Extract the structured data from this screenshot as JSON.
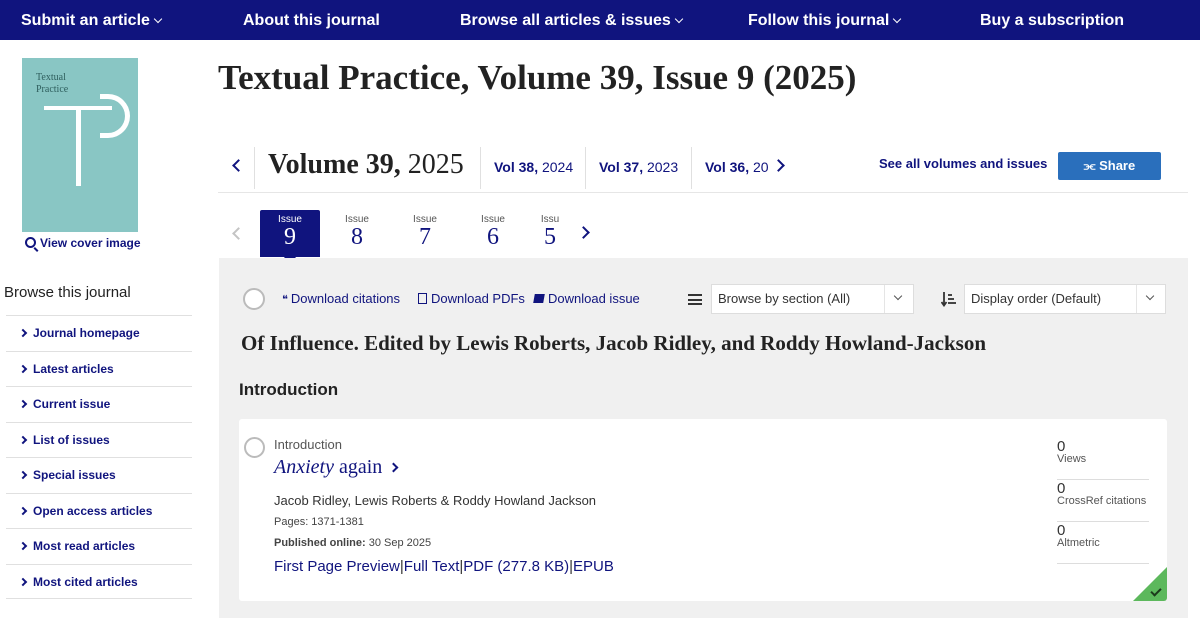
{
  "topnav": {
    "items": [
      {
        "label": "Submit an article",
        "dropdown": true
      },
      {
        "label": "About this journal",
        "dropdown": false
      },
      {
        "label": "Browse all articles & issues",
        "dropdown": true
      },
      {
        "label": "Follow this journal",
        "dropdown": true
      },
      {
        "label": "Buy a subscription",
        "dropdown": false
      }
    ]
  },
  "cover": {
    "title_line1": "Textual",
    "title_line2": "Practice",
    "view_label": "View cover image"
  },
  "sidebar": {
    "title": "Browse this journal",
    "items": [
      {
        "label": "Journal homepage"
      },
      {
        "label": "Latest articles"
      },
      {
        "label": "Current issue"
      },
      {
        "label": "List of issues"
      },
      {
        "label": "Special issues"
      },
      {
        "label": "Open access articles"
      },
      {
        "label": "Most read articles"
      },
      {
        "label": "Most cited articles"
      }
    ]
  },
  "page_title": "Textual Practice, Volume 39, Issue 9 (2025)",
  "volumes": {
    "current_label": "Volume 39,",
    "current_year": "2025",
    "others": [
      {
        "vol": "Vol 38,",
        "year": "2024"
      },
      {
        "vol": "Vol 37,",
        "year": "2023"
      },
      {
        "vol": "Vol 36,",
        "year": "20"
      }
    ],
    "see_all": "See all volumes and issues",
    "share": "Share"
  },
  "issues": {
    "label": "Issue",
    "tabs": [
      {
        "number": "9",
        "active": true
      },
      {
        "number": "8",
        "active": false
      },
      {
        "number": "7",
        "active": false
      },
      {
        "number": "6",
        "active": false
      },
      {
        "number": "5",
        "active": false
      }
    ],
    "partial_label": "Issu"
  },
  "toolbar": {
    "download_citations": "Download citations",
    "download_pdfs": "Download PDFs",
    "download_issue": "Download issue",
    "browse_section": "Browse by section (All)",
    "display_order": "Display order (Default)"
  },
  "section_heading": "Of Influence. Edited by Lewis Roberts, Jacob Ridley, and Roddy Howland-Jackson",
  "subsection": "Introduction",
  "article": {
    "type": "Introduction",
    "title_italic": "Anxiety",
    "title_rest": " again",
    "authors": "Jacob Ridley, Lewis Roberts & Roddy Howland Jackson",
    "pages": "Pages: 1371-1381",
    "published_label": "Published online:",
    "published_date": " 30 Sep 2025",
    "links": {
      "preview": "First Page Preview",
      "full_text": "Full Text",
      "pdf": "PDF (277.8 KB)",
      "epub": "EPUB",
      "separator": "|"
    },
    "metrics": [
      {
        "value": "0",
        "label": "Views"
      },
      {
        "value": "0",
        "label": "CrossRef citations"
      },
      {
        "value": "0",
        "label": "Altmetric"
      }
    ],
    "open_access": true
  },
  "colors": {
    "nav_bg": "#10147e",
    "link": "#10147e",
    "share_btn": "#2a6fbc",
    "panel_bg": "#f0f0f0",
    "cover_bg": "#89c6c4",
    "oa_green": "#5cb85c"
  },
  "icons": {
    "cover": "magnifier-icon",
    "citations": "quote-icon",
    "pdfs": "document-icon",
    "issue": "book-icon",
    "list": "list-icon",
    "sort": "sort-icon",
    "share": "share-icon",
    "oa": "checkmark-icon"
  }
}
